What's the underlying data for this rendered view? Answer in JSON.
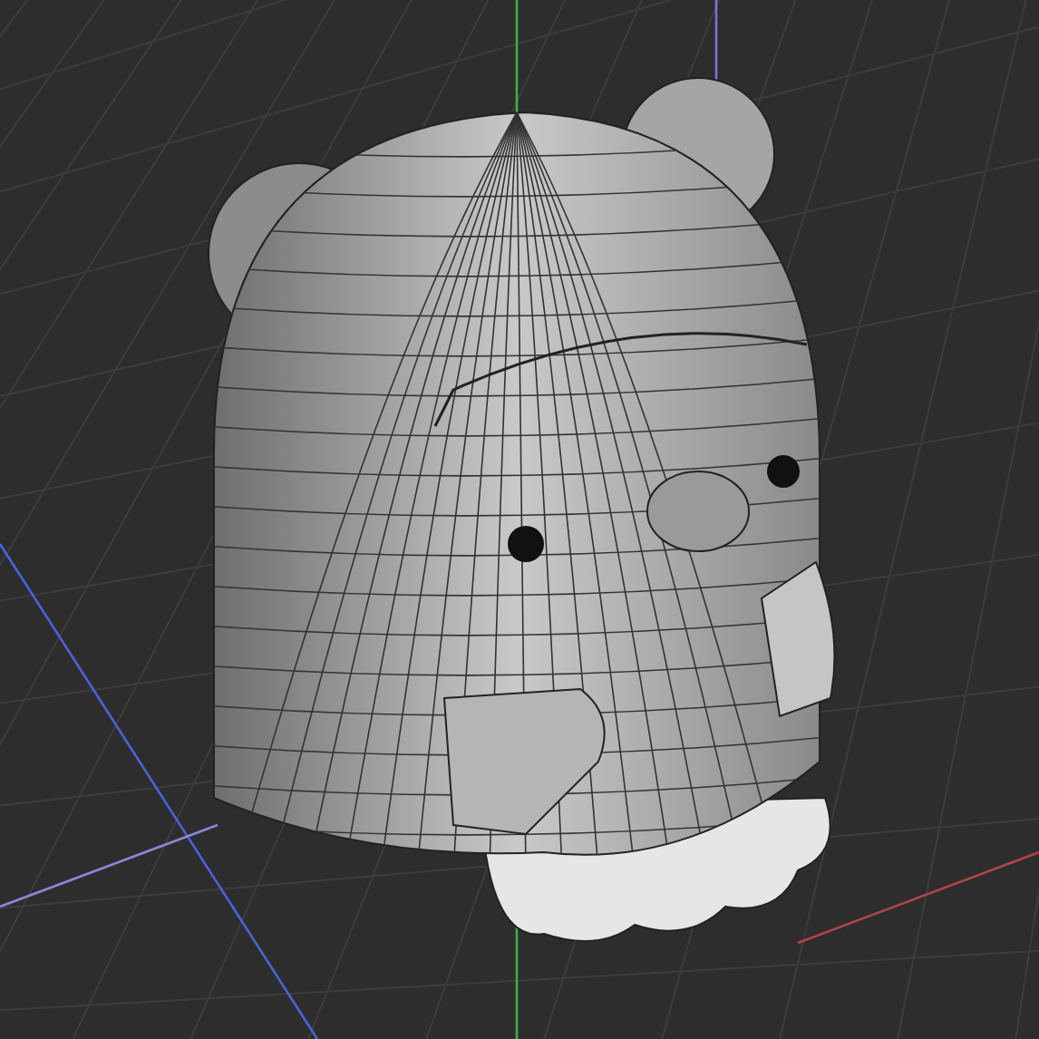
{
  "viewport": {
    "show_grid": true,
    "show_axes": true
  }
}
